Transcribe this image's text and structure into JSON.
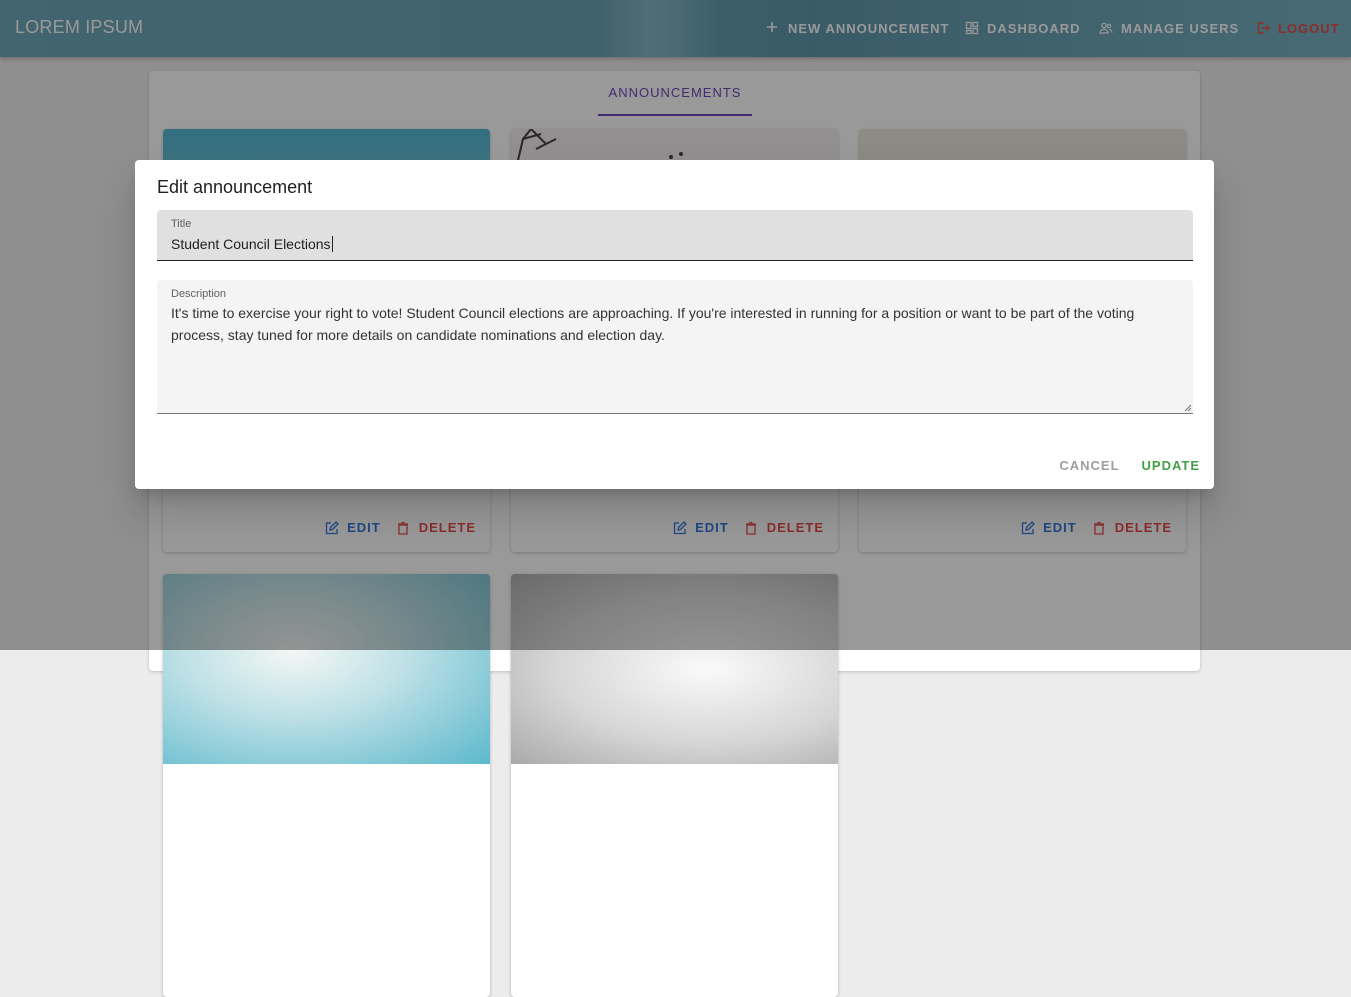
{
  "appbar": {
    "brand": "LOREM IPSUM",
    "nav": [
      {
        "label": "NEW ANNOUNCEMENT",
        "icon": "plus-icon"
      },
      {
        "label": "DASHBOARD",
        "icon": "dashboard-icon"
      },
      {
        "label": "MANAGE USERS",
        "icon": "users-icon"
      },
      {
        "label": "LOGOUT",
        "icon": "logout-icon"
      }
    ]
  },
  "tabs": {
    "active": "ANNOUNCEMENTS"
  },
  "cards": {
    "edit_label": "EDIT",
    "delete_label": "DELETE"
  },
  "dialog": {
    "title": "Edit announcement",
    "title_field": {
      "label": "Title",
      "value": "Student Council Elections"
    },
    "description_field": {
      "label": "Description",
      "value": "It's time to exercise your right to vote! Student Council elections are approaching. If you're interested in running for a position or want to be part of the voting process, stay tuned for more details on candidate nominations and election day."
    },
    "cancel_label": "CANCEL",
    "update_label": "UPDATE"
  },
  "colors": {
    "appbar": "#5b99ad",
    "tab_active": "#5e35b1",
    "edit": "#1e6ad8",
    "delete": "#e53935",
    "update": "#43a047",
    "cancel": "#9e9e9e"
  }
}
